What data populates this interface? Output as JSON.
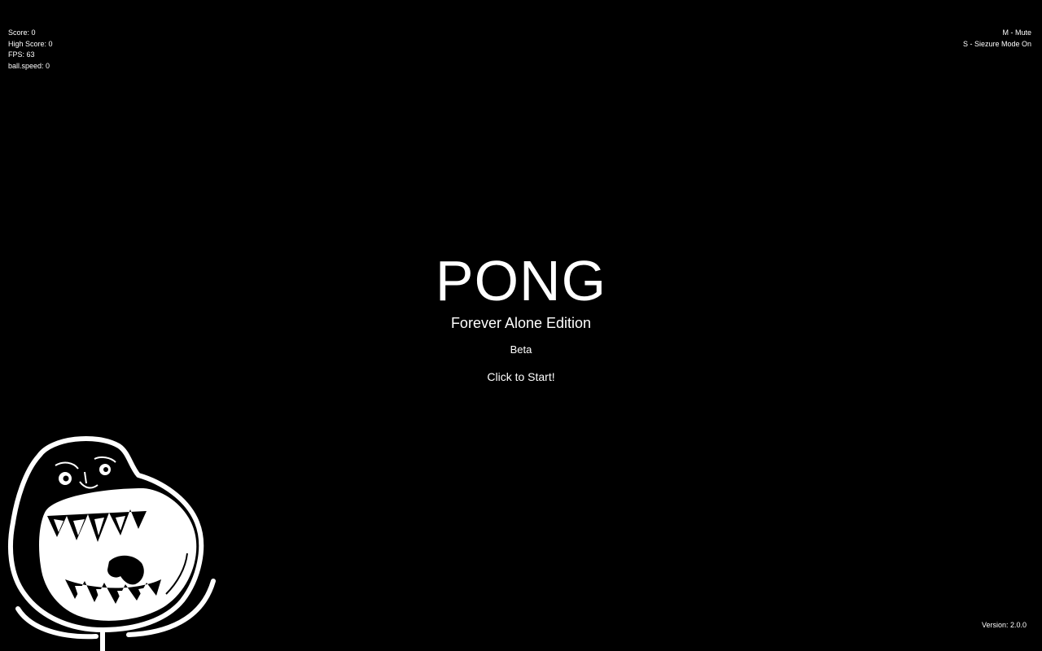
{
  "hud_left": {
    "score": "Score: 0",
    "high_score": "High Score: 0",
    "fps": "FPS: 63",
    "ball_speed": "ball.speed: 0"
  },
  "hud_right": {
    "mute": "M - Mute",
    "seizure": "S - Siezure Mode On"
  },
  "title": {
    "main": "PONG",
    "subtitle": "Forever Alone Edition",
    "tag": "Beta",
    "start": "Click to Start!"
  },
  "version": "Version: 2.0.0",
  "mascot": {
    "icon": "forever-alone-face-icon"
  },
  "colors": {
    "background": "#000000",
    "foreground": "#ffffff"
  }
}
